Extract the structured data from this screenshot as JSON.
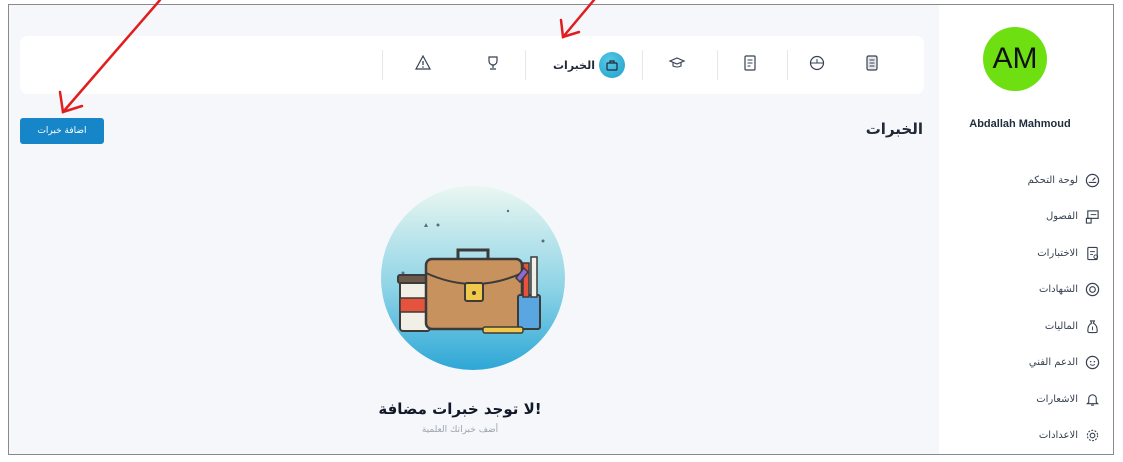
{
  "user": {
    "initials": "AM",
    "name": "Abdallah Mahmoud",
    "avatar_color": "#6ee012"
  },
  "sidebar": {
    "items": [
      {
        "label": "لوحة التحكم",
        "icon": "dashboard-icon"
      },
      {
        "label": "الفصول",
        "icon": "classroom-icon"
      },
      {
        "label": "الاختبارات",
        "icon": "exam-icon"
      },
      {
        "label": "الشهادات",
        "icon": "certificate-icon"
      },
      {
        "label": "الماليات",
        "icon": "money-bag-icon"
      },
      {
        "label": "الدعم الفني",
        "icon": "support-icon"
      },
      {
        "label": "الاشعارات",
        "icon": "bell-icon"
      },
      {
        "label": "الاعدادات",
        "icon": "gear-icon"
      }
    ]
  },
  "profile_tabs": {
    "items": [
      {
        "icon": "document-icon",
        "label": ""
      },
      {
        "icon": "clock-icon",
        "label": ""
      },
      {
        "icon": "notes-icon",
        "label": ""
      },
      {
        "icon": "graduation-cap-icon",
        "label": ""
      },
      {
        "icon": "experience-icon",
        "label": "الخبرات",
        "active": true
      },
      {
        "icon": "trophy-icon",
        "label": ""
      },
      {
        "icon": "warning-icon",
        "label": ""
      }
    ]
  },
  "page": {
    "title": "الخبرات",
    "add_button_label": "اضافة خبرات",
    "empty_title": "لا توجد خبرات مضافة!",
    "empty_subtitle": "أضف خبراتك العلمية"
  },
  "colors": {
    "accent": "#1686c9",
    "active_tab": "#1fa0c8",
    "annotation_arrow": "#e11d1d",
    "page_background": "#f6f7fb"
  }
}
